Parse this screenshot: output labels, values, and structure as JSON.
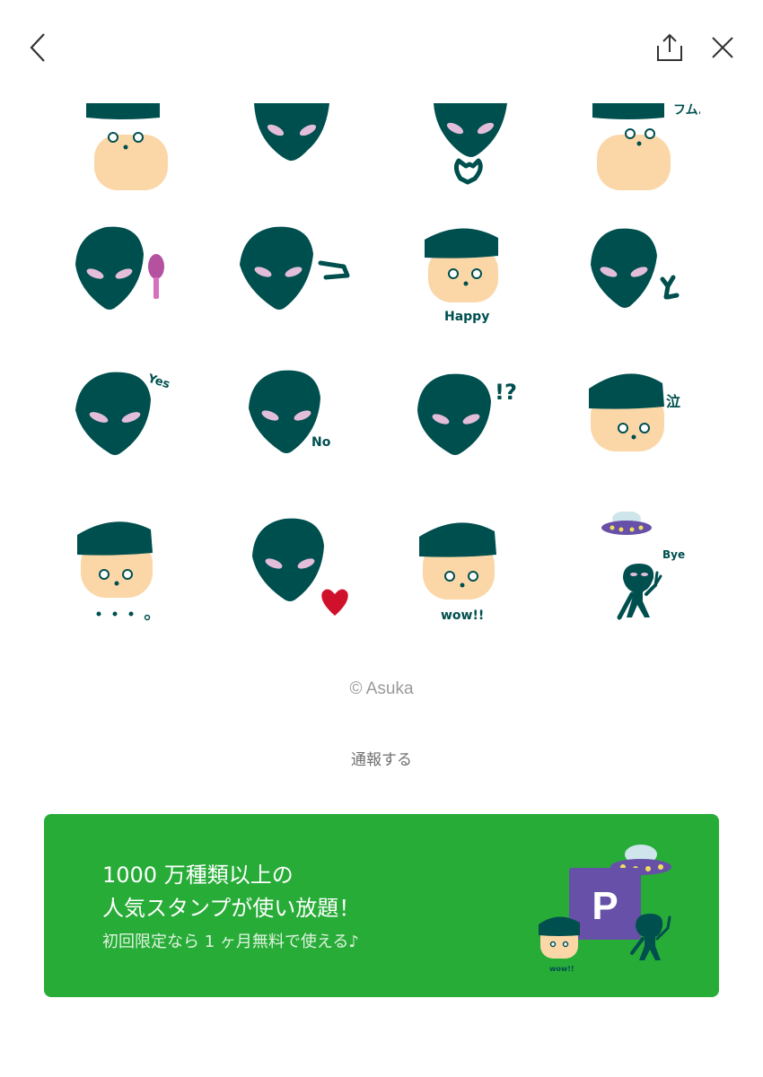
{
  "header": {
    "back_icon": "chevron-left-icon",
    "share_icon": "share-icon",
    "close_icon": "close-icon"
  },
  "stickers": [
    {
      "name": "boy-face",
      "caption": ""
    },
    {
      "name": "alien-face",
      "caption": ""
    },
    {
      "name": "alien-heart-hands",
      "caption": ""
    },
    {
      "name": "boy-hmm",
      "caption": "フム."
    },
    {
      "name": "alien-fan",
      "caption": ""
    },
    {
      "name": "alien-arrow",
      "caption": ""
    },
    {
      "name": "boy-happy",
      "caption": "Happy"
    },
    {
      "name": "alien-peace",
      "caption": ""
    },
    {
      "name": "alien-yes",
      "caption": "Yes"
    },
    {
      "name": "alien-no",
      "caption": "No"
    },
    {
      "name": "alien-exclaim",
      "caption": "!?"
    },
    {
      "name": "boy-cry",
      "caption": "泣"
    },
    {
      "name": "boy-dots",
      "caption": ""
    },
    {
      "name": "alien-love",
      "caption": ""
    },
    {
      "name": "boy-wow",
      "caption": "wow!!"
    },
    {
      "name": "alien-ufo-bye",
      "caption": "Bye"
    }
  ],
  "copyright": "© Asuka",
  "report_label": "通報する",
  "banner": {
    "line1": "1000 万種類以上の",
    "line2": "人気スタンプが使い放題！",
    "line3": "初回限定なら 1 ヶ月無料で使える♪",
    "badge_letter": "P",
    "art_caption": "wow!!"
  },
  "colors": {
    "alien": "#004f4f",
    "alien_eye": "#e3bedb",
    "skin": "#fbd7a8",
    "banner_bg": "#28ac38",
    "badge": "#6650a8",
    "heart": "#d0112b"
  }
}
